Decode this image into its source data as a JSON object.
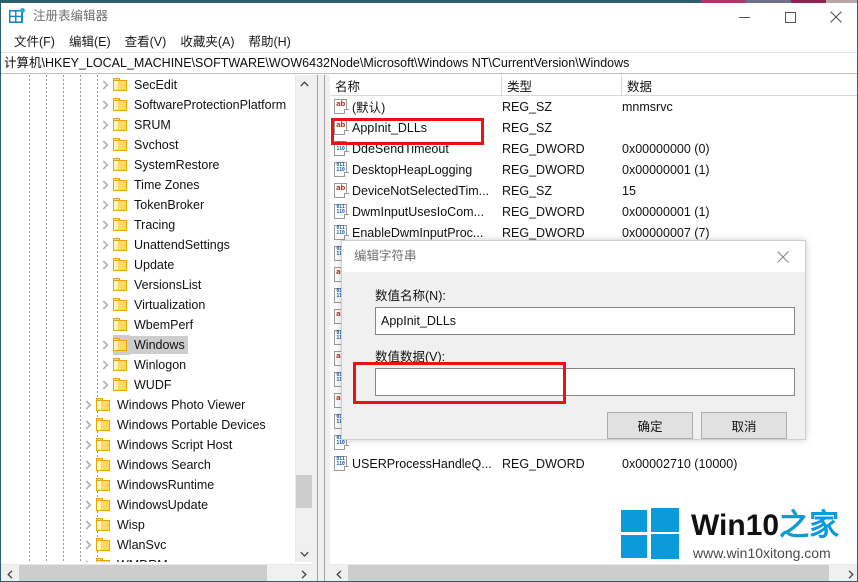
{
  "window": {
    "title": "注册表编辑器",
    "app_icon": "registry-editor-icon",
    "minimize_label": "最小化",
    "maximize_label": "最大化",
    "close_label": "关闭",
    "accent_colors": [
      "#2e5d6b",
      "#b5346b",
      "#8f2350",
      "#b9a8a8"
    ]
  },
  "menubar": {
    "items": [
      {
        "label": "文件(F)"
      },
      {
        "label": "编辑(E)"
      },
      {
        "label": "查看(V)"
      },
      {
        "label": "收藏夹(A)"
      },
      {
        "label": "帮助(H)"
      }
    ]
  },
  "address": {
    "path": "计算机\\HKEY_LOCAL_MACHINE\\SOFTWARE\\WOW6432Node\\Microsoft\\Windows NT\\CurrentVersion\\Windows"
  },
  "tree": {
    "nodes": [
      {
        "label": "SecEdit",
        "indent": 5,
        "expandable": true,
        "selected": false
      },
      {
        "label": "SoftwareProtectionPlatform",
        "indent": 5,
        "expandable": true,
        "selected": false
      },
      {
        "label": "SRUM",
        "indent": 5,
        "expandable": true,
        "selected": false
      },
      {
        "label": "Svchost",
        "indent": 5,
        "expandable": true,
        "selected": false
      },
      {
        "label": "SystemRestore",
        "indent": 5,
        "expandable": true,
        "selected": false
      },
      {
        "label": "Time Zones",
        "indent": 5,
        "expandable": true,
        "selected": false
      },
      {
        "label": "TokenBroker",
        "indent": 5,
        "expandable": true,
        "selected": false
      },
      {
        "label": "Tracing",
        "indent": 5,
        "expandable": true,
        "selected": false
      },
      {
        "label": "UnattendSettings",
        "indent": 5,
        "expandable": true,
        "selected": false
      },
      {
        "label": "Update",
        "indent": 5,
        "expandable": true,
        "selected": false
      },
      {
        "label": "VersionsList",
        "indent": 5,
        "expandable": false,
        "selected": false
      },
      {
        "label": "Virtualization",
        "indent": 5,
        "expandable": true,
        "selected": false
      },
      {
        "label": "WbemPerf",
        "indent": 5,
        "expandable": false,
        "selected": false
      },
      {
        "label": "Windows",
        "indent": 5,
        "expandable": true,
        "selected": true
      },
      {
        "label": "Winlogon",
        "indent": 5,
        "expandable": true,
        "selected": false
      },
      {
        "label": "WUDF",
        "indent": 5,
        "expandable": true,
        "selected": false
      },
      {
        "label": "Windows Photo Viewer",
        "indent": 4,
        "expandable": true,
        "selected": false
      },
      {
        "label": "Windows Portable Devices",
        "indent": 4,
        "expandable": true,
        "selected": false
      },
      {
        "label": "Windows Script Host",
        "indent": 4,
        "expandable": true,
        "selected": false
      },
      {
        "label": "Windows Search",
        "indent": 4,
        "expandable": true,
        "selected": false
      },
      {
        "label": "WindowsRuntime",
        "indent": 4,
        "expandable": true,
        "selected": false
      },
      {
        "label": "WindowsUpdate",
        "indent": 4,
        "expandable": true,
        "selected": false
      },
      {
        "label": "Wisp",
        "indent": 4,
        "expandable": true,
        "selected": false
      },
      {
        "label": "WlanSvc",
        "indent": 4,
        "expandable": true,
        "selected": false
      },
      {
        "label": "WMDRM",
        "indent": 4,
        "expandable": true,
        "selected": false
      }
    ],
    "scroll_up_icon": "chevron-up-icon",
    "scroll_down_icon": "chevron-down-icon",
    "scroll_left_icon": "chevron-left-icon",
    "scroll_right_icon": "chevron-right-icon"
  },
  "list": {
    "columns": [
      {
        "label": "名称",
        "key": "name"
      },
      {
        "label": "类型",
        "key": "type"
      },
      {
        "label": "数据",
        "key": "data"
      }
    ],
    "rows": [
      {
        "name": "(默认)",
        "type": "REG_SZ",
        "data": "mnmsrvc",
        "icon": "string-value-icon"
      },
      {
        "name": "AppInit_DLLs",
        "type": "REG_SZ",
        "data": "",
        "icon": "string-value-icon"
      },
      {
        "name": "DdeSendTimeout",
        "type": "REG_DWORD",
        "data": "0x00000000 (0)",
        "icon": "dword-value-icon"
      },
      {
        "name": "DesktopHeapLogging",
        "type": "REG_DWORD",
        "data": "0x00000001 (1)",
        "icon": "dword-value-icon"
      },
      {
        "name": "DeviceNotSelectedTim...",
        "type": "REG_SZ",
        "data": "15",
        "icon": "string-value-icon"
      },
      {
        "name": "DwmInputUsesIoCom...",
        "type": "REG_DWORD",
        "data": "0x00000001 (1)",
        "icon": "dword-value-icon"
      },
      {
        "name": "EnableDwmInputProc...",
        "type": "REG_DWORD",
        "data": "0x00000007 (7)",
        "icon": "dword-value-icon"
      },
      {
        "name": "",
        "type": "",
        "data": "",
        "icon": "dword-value-icon"
      },
      {
        "name": "",
        "type": "",
        "data": "",
        "icon": "string-value-icon"
      },
      {
        "name": "",
        "type": "",
        "data": "",
        "icon": "dword-value-icon"
      },
      {
        "name": "",
        "type": "",
        "data": "",
        "icon": "string-value-icon"
      },
      {
        "name": "",
        "type": "",
        "data": "",
        "icon": "dword-value-icon"
      },
      {
        "name": "",
        "type": "",
        "data": "",
        "icon": "string-value-icon"
      },
      {
        "name": "",
        "type": "",
        "data": "",
        "icon": "dword-value-icon"
      },
      {
        "name": "",
        "type": "",
        "data": "",
        "icon": "string-value-icon"
      },
      {
        "name": "",
        "type": "",
        "data": "",
        "icon": "dword-value-icon"
      },
      {
        "name": "",
        "type": "",
        "data": "",
        "icon": "dword-value-icon"
      },
      {
        "name": "USERProcessHandleQ...",
        "type": "REG_DWORD",
        "data": "0x00002710 (10000)",
        "icon": "dword-value-icon"
      }
    ]
  },
  "dialog": {
    "title": "编辑字符串",
    "close_icon": "close-icon",
    "name_label": "数值名称(N):",
    "name_value": "AppInit_DLLs",
    "data_label": "数值数据(V):",
    "data_value": "",
    "ok_label": "确定",
    "cancel_label": "取消"
  },
  "annotations": {
    "highlight_color": "#ee1111",
    "boxes": [
      {
        "name": "appinit-dlls-row-highlight"
      },
      {
        "name": "value-data-input-highlight"
      }
    ]
  },
  "watermark": {
    "brand_main": "Win10",
    "brand_suffix": "之家",
    "url": "www.win10xitong.com",
    "logo_color": "#0a9bd8"
  }
}
